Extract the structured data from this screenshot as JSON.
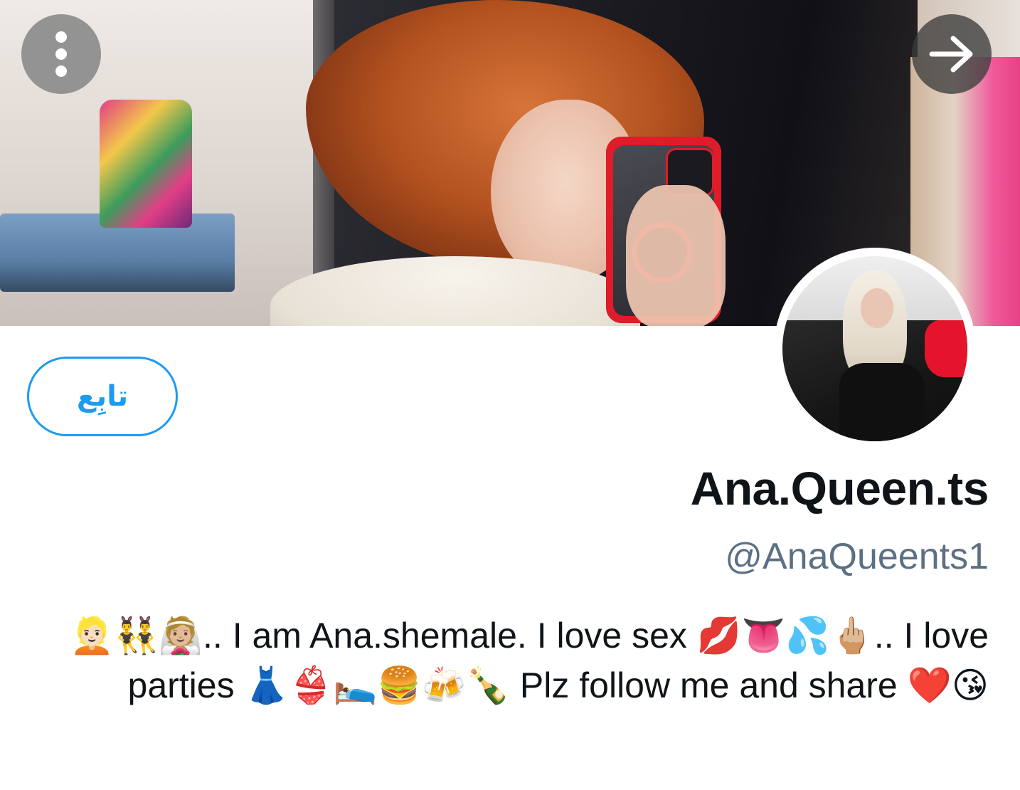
{
  "header": {
    "menu_icon": "more-vertical-icon",
    "next_icon": "arrow-right-icon"
  },
  "profile": {
    "follow_label": "تابِع",
    "display_name": "Ana.Queen.ts",
    "handle": "@AnaQueents1",
    "bio": "👱🏻👯‍♂️👰🏼.. I am Ana.shemale. I love sex 💋👅💦🖕🏼.. I love parties 👗👙🛌🍔🍻🍾 Plz follow me and share ❤️😘"
  },
  "colors": {
    "accent": "#1d9bf0",
    "handle": "#5b7083",
    "text": "#0f1419"
  }
}
